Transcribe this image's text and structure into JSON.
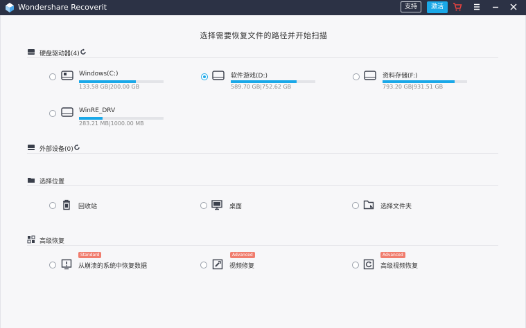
{
  "window": {
    "title": "Wondershare Recoverit",
    "support_label": "支持",
    "register_label": "激活",
    "cart_icon": "cart-icon",
    "menu_icon": "menu-icon",
    "minimize_icon": "minimize-icon",
    "close_icon": "close-icon"
  },
  "headline": "选择需要恢复文件的路径并开始扫描",
  "colors": {
    "accent": "#1aa8e8",
    "titlebar": "#2c3245",
    "badge": "#f07d6e",
    "cart": "#e8423f"
  },
  "sections": {
    "hard_drives": {
      "label": "硬盘驱动器(4)",
      "drives": [
        {
          "name": "Windows(C:)",
          "size": "133.58 GB|200.00 GB",
          "used_fraction": 0.67,
          "selected": false
        },
        {
          "name": "软件游戏(D:)",
          "size": "589.70 GB|752.62 GB",
          "used_fraction": 0.78,
          "selected": true
        },
        {
          "name": "资料存储(F:)",
          "size": "793.20 GB|931.51 GB",
          "used_fraction": 0.85,
          "selected": false
        },
        {
          "name": "WinRE_DRV",
          "size": "283.21 MB|1000.00 MB",
          "used_fraction": 0.28,
          "selected": false
        }
      ]
    },
    "external": {
      "label": "外部设备(0)"
    },
    "location": {
      "label": "选择位置",
      "items": [
        {
          "label": "回收站",
          "icon": "recycle-bin-icon"
        },
        {
          "label": "桌面",
          "icon": "desktop-icon"
        },
        {
          "label": "选择文件夹",
          "icon": "folder-icon"
        }
      ]
    },
    "advanced": {
      "label": "高级恢复",
      "items": [
        {
          "label": "从崩溃的系统中恢复数据",
          "badge": "Standard",
          "icon": "crashed-system-icon"
        },
        {
          "label": "视频修复",
          "badge": "Advanced",
          "icon": "video-repair-icon"
        },
        {
          "label": "高级视频恢复",
          "badge": "Advanced",
          "icon": "advanced-video-icon"
        }
      ]
    }
  }
}
